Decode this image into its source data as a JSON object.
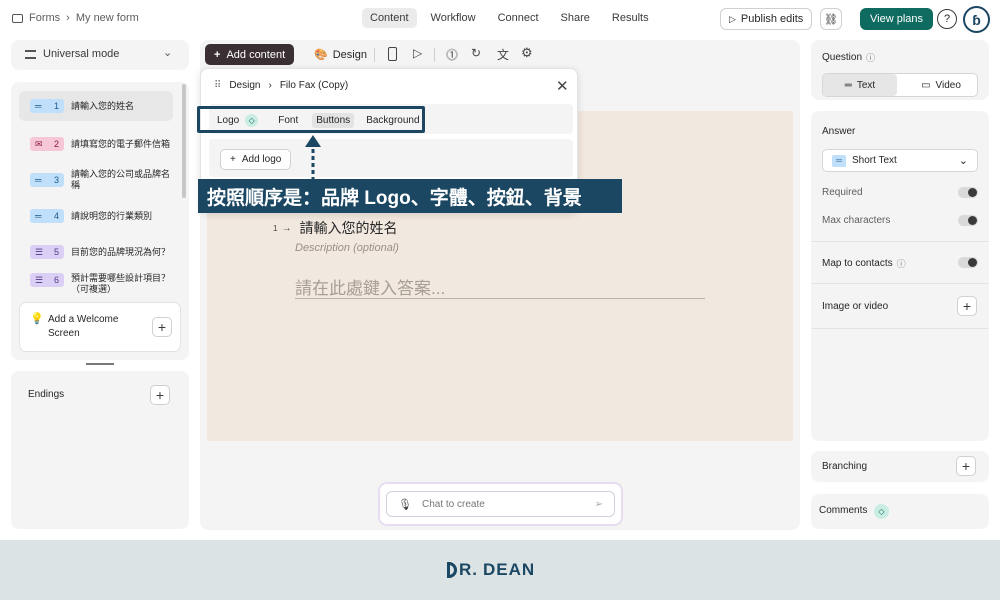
{
  "topbar": {
    "breadcrumb_root": "Forms",
    "breadcrumb_current": "My new form",
    "tabs": [
      "Content",
      "Workflow",
      "Connect",
      "Share",
      "Results"
    ],
    "active_tab": "Content",
    "publish_label": "Publish edits",
    "view_plans_label": "View plans",
    "help_glyph": "?",
    "avatar_text": "ɓ"
  },
  "sidebar": {
    "mode_label": "Universal mode",
    "questions": [
      {
        "num": "1",
        "label": "請輸入您的姓名",
        "type": "short-text-icon",
        "color": "blue"
      },
      {
        "num": "2",
        "label": "請填寫您的電子郵件信箱",
        "type": "email-icon",
        "color": "pink"
      },
      {
        "num": "3",
        "label": "請輸入您的公司或品牌名稱",
        "type": "short-text-icon",
        "color": "blue"
      },
      {
        "num": "4",
        "label": "請說明您的行業類別",
        "type": "short-text-icon",
        "color": "blue"
      },
      {
        "num": "5",
        "label": "目前您的品牌現況為何？",
        "type": "multiple-choice-icon",
        "color": "purple"
      },
      {
        "num": "6",
        "label": "預計需要哪些設計項目？（可複選）",
        "type": "multiple-choice-icon",
        "color": "purple"
      }
    ],
    "welcome_label": "Add a Welcome Screen",
    "endings_label": "Endings"
  },
  "toolbar": {
    "add_content_label": "Add content",
    "design_label": "Design"
  },
  "design_popup": {
    "title_root": "Design",
    "title_current": "Filo Fax (Copy)",
    "tabs": [
      "Logo",
      "Font",
      "Buttons",
      "Background"
    ],
    "add_logo_label": "Add logo"
  },
  "canvas": {
    "question_num": "1",
    "question_text": "請輸入您的姓名",
    "description_placeholder": "Description (optional)",
    "answer_placeholder": "請在此處鍵入答案..."
  },
  "chat": {
    "placeholder": "Chat to create"
  },
  "right_panel": {
    "question_label": "Question",
    "text_tab": "Text",
    "video_tab": "Video",
    "answer_label": "Answer",
    "answer_type": "Short Text",
    "required_label": "Required",
    "max_chars_label": "Max characters",
    "map_contacts_label": "Map to contacts",
    "image_video_label": "Image or video",
    "branching_label": "Branching",
    "comments_label": "Comments"
  },
  "annotation": {
    "text": "按照順序是：品牌 Logo、字體、按鈕、背景"
  },
  "footer": {
    "brand_prefix": "R.",
    "brand_name": "DEAN"
  },
  "colors": {
    "accent": "#0f6a60",
    "annotation_bg": "#1b4763",
    "canvas_bg": "#f1e8df",
    "footer_bg": "#dbe3e5"
  }
}
